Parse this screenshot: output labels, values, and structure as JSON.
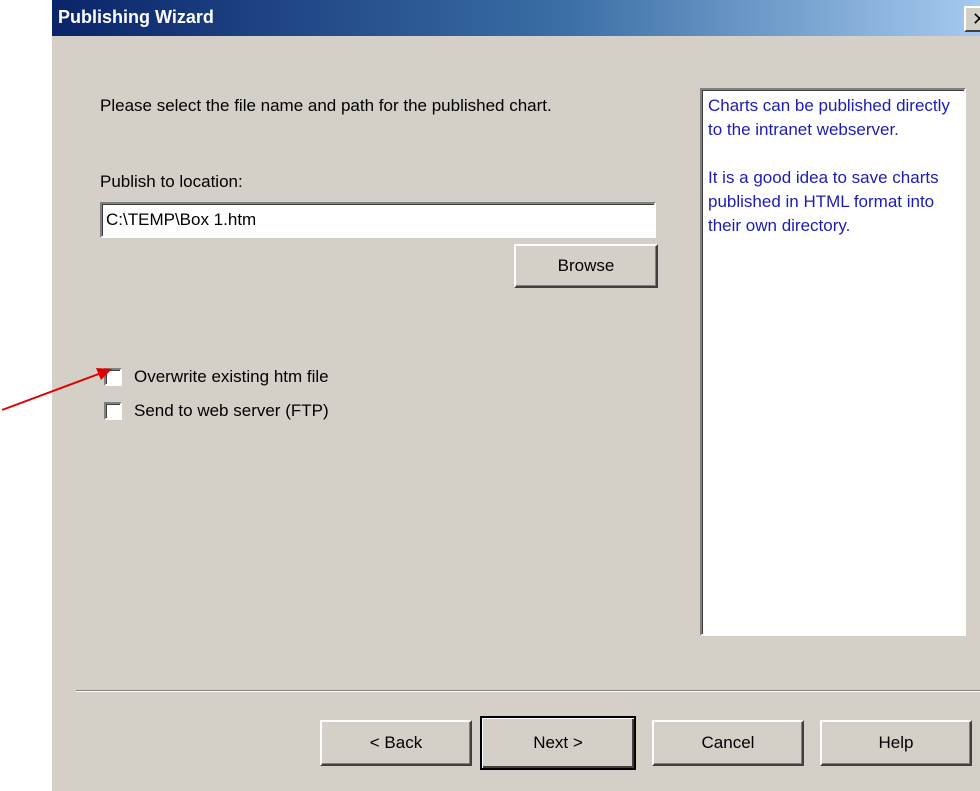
{
  "window": {
    "title": "Publishing Wizard",
    "close_glyph": "✕"
  },
  "main": {
    "instruction": "Please select the file name and path for the published chart.",
    "location_label": "Publish to location:",
    "location_value": "C:\\TEMP\\Box 1.htm",
    "browse_label": "Browse"
  },
  "options": {
    "overwrite_label": "Overwrite existing htm file",
    "overwrite_checked": false,
    "ftp_label": "Send to web server (FTP)",
    "ftp_checked": false
  },
  "help_panel": {
    "para1": "Charts can be published directly to the intranet webserver.",
    "para2": "It is a good idea to save charts published in HTML format into their own directory.",
    "text_color": "#1c1cb4"
  },
  "footer": {
    "back_label": "< Back",
    "next_label": "Next >",
    "cancel_label": "Cancel",
    "help_label": "Help"
  },
  "annotation": {
    "arrow_color": "#e00000",
    "arrow_icon": "red-pointer-arrow"
  },
  "colors": {
    "dialog_bg": "#d4d0c8",
    "titlebar_start": "#0a246a",
    "titlebar_end": "#a6caf0"
  }
}
